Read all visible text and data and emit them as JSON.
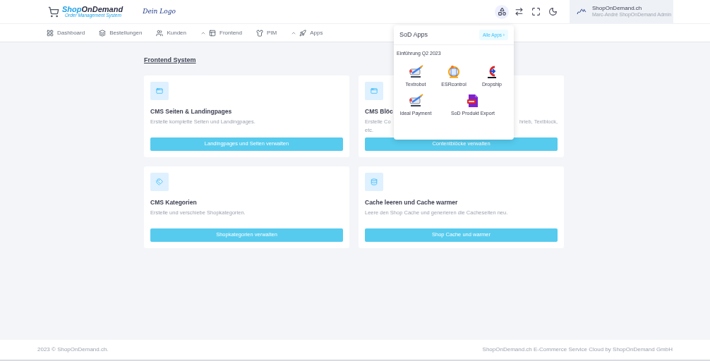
{
  "header": {
    "brand": {
      "name_a": "Shop",
      "name_b": "OnDemand",
      "tagline": "Order Management System"
    },
    "secondary_logo": "Dein Logo",
    "icons": [
      {
        "kind": "apps",
        "selected": true
      },
      {
        "kind": "switch",
        "selected": false
      },
      {
        "kind": "fullscreen",
        "selected": false
      },
      {
        "kind": "moon",
        "selected": false
      }
    ],
    "profile": {
      "name": "ShopOnDemand.ch",
      "role": "Marc-André ShopOnDemand Admin"
    }
  },
  "nav": [
    {
      "label": "Dashboard",
      "expanded": false
    },
    {
      "label": "Bestellungen",
      "expanded": false
    },
    {
      "label": "Kunden",
      "expanded": false
    },
    {
      "label": "Frontend",
      "expanded": true
    },
    {
      "label": "PIM",
      "expanded": false
    },
    {
      "label": "Apps",
      "expanded": true
    }
  ],
  "section_title": "Frontend System",
  "cards": [
    {
      "title": "CMS Seiten & Landingpages",
      "description": [
        "Erstelle komplette Seiten und Landingpages."
      ],
      "button": "Landingpages und Seiten verwalten"
    },
    {
      "title": "CMS Blöc",
      "description": [
        "Erstelle Co",
        "hrieb, Textblock,",
        "etc."
      ],
      "button": "Contentblöcke verwalten"
    },
    {
      "title": "CMS Kategorien",
      "description": [
        "Erstelle und verschiebe Shopkategorien."
      ],
      "button": "Shopkategorien verwalten"
    },
    {
      "title": "Cache leeren und Cache warmer",
      "description": [
        "Leere den Shop Cache und generieren die Cacheseiten neu."
      ],
      "button": "Shop Cache und warmer"
    }
  ],
  "apps_menu": {
    "title": "SoD Apps",
    "all_link": "Alle Apps",
    "all_link_arrow": "›",
    "subtitle": "Einführung Q2 2023",
    "apps": [
      {
        "name": "Textrobot",
        "kind": "robot"
      },
      {
        "name": "ESRcontrol",
        "kind": "esr"
      },
      {
        "name": "Dropship",
        "kind": "dropship"
      },
      {
        "name": "Ideal Payment",
        "kind": "robot"
      },
      {
        "name": "SoD Produkt Export",
        "kind": "csv"
      }
    ]
  },
  "footer": {
    "left": "2023 © ShopOnDemand.ch.",
    "right": "ShopOnDemand.ch E-Commerce Service Cloud by ShopOnDemand GmbH"
  }
}
